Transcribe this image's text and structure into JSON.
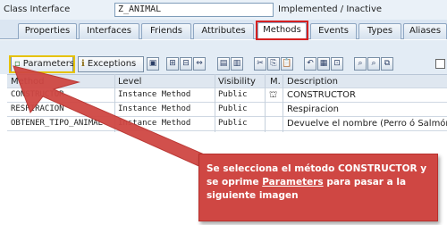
{
  "header": {
    "class_interface_label": "Class Interface",
    "class_name": "Z_ANIMAL",
    "status": "Implemented / Inactive"
  },
  "tabs": [
    "Properties",
    "Interfaces",
    "Friends",
    "Attributes",
    "Methods",
    "Events",
    "Types",
    "Aliases"
  ],
  "active_tab": "Methods",
  "toolbar": {
    "parameters_label": "Parameters",
    "exceptions_label": "Exceptions"
  },
  "table": {
    "columns": [
      "Method",
      "Level",
      "Visibility",
      "M.",
      "Description"
    ],
    "rows": [
      {
        "method": "CONSTRUCTOR",
        "level": "Instance Method",
        "visibility": "Public",
        "description": "CONSTRUCTOR"
      },
      {
        "method": "RESPIRACION",
        "level": "Instance Method",
        "visibility": "Public",
        "description": "Respiracion"
      },
      {
        "method": "OBTENER_TIPO_ANIMAL",
        "level": "Instance Method",
        "visibility": "Public",
        "description": "Devuelve el nombre (Perro ó Salmón)"
      }
    ]
  },
  "callout": {
    "part1": "Se selecciona el método CONSTRUCTOR y se oprime ",
    "link": "Parameters",
    "part2": " para pasar a la siguiente imagen"
  },
  "colors": {
    "callout": "#cf4743",
    "tab_highlight": "#d62020",
    "button_highlight": "#e6c200"
  }
}
